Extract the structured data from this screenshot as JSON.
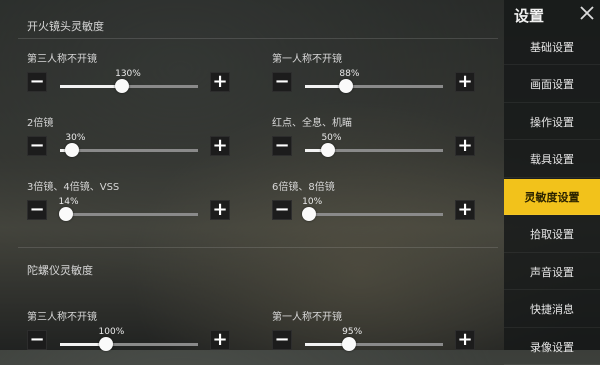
{
  "sections": {
    "scope_sensitivity": "开火镜头灵敏度",
    "gyro_sensitivity": "陀螺仪灵敏度"
  },
  "sliders": [
    {
      "label": "第三人称不开镜",
      "value": "130%",
      "fraction": 0.45
    },
    {
      "label": "第一人称不开镜",
      "value": "88%",
      "fraction": 0.3
    },
    {
      "label": "2倍镜",
      "value": "30%",
      "fraction": 0.09
    },
    {
      "label": "红点、全息、机瞄",
      "value": "50%",
      "fraction": 0.17
    },
    {
      "label": "3倍镜、4倍镜、VSS",
      "value": "14%",
      "fraction": 0.04
    },
    {
      "label": "6倍镜、8倍镜",
      "value": "10%",
      "fraction": 0.03
    },
    {
      "label": "第三人称不开镜",
      "value": "100%",
      "fraction": 0.33
    },
    {
      "label": "第一人称不开镜",
      "value": "95%",
      "fraction": 0.32
    }
  ],
  "buttons": {
    "minus": "−",
    "plus": "+"
  },
  "sidebar": {
    "title": "设置",
    "items": [
      {
        "label": "基础设置",
        "active": false
      },
      {
        "label": "画面设置",
        "active": false
      },
      {
        "label": "操作设置",
        "active": false
      },
      {
        "label": "载具设置",
        "active": false
      },
      {
        "label": "灵敏度设置",
        "active": true
      },
      {
        "label": "拾取设置",
        "active": false
      },
      {
        "label": "声音设置",
        "active": false
      },
      {
        "label": "快捷消息",
        "active": false
      },
      {
        "label": "录像设置",
        "active": false
      }
    ]
  },
  "colors": {
    "accent": "#f2c21b"
  },
  "icons": {
    "close": "close-icon"
  }
}
